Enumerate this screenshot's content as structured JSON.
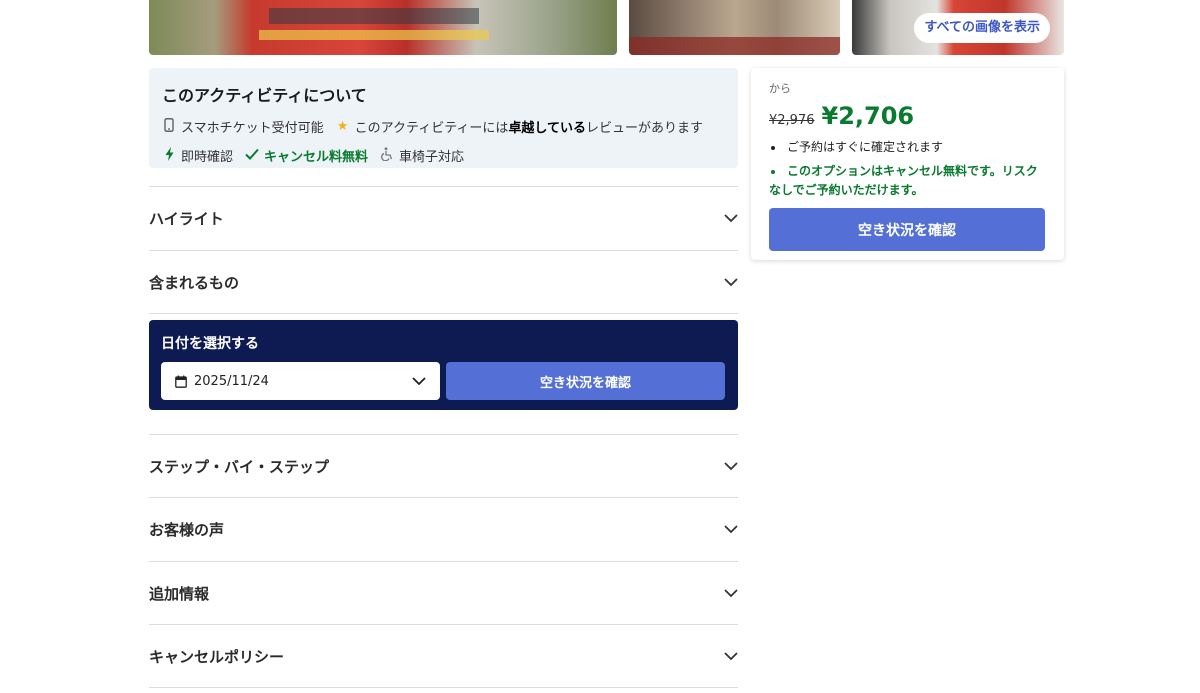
{
  "gallery": {
    "show_all_label": "すべての画像を表示"
  },
  "about": {
    "title": "このアクティビティについて",
    "features_row1": [
      {
        "icon": "mobile-phone-icon",
        "text": "スマホチケット受付可能"
      },
      {
        "icon": "star-icon",
        "pre": "このアクティビティーには",
        "bold": "卓越している",
        "post": "レビューがあります"
      }
    ],
    "features_row2": [
      {
        "icon": "lightning-bolt-icon",
        "text": "即時確認"
      },
      {
        "icon": "checkmark-icon",
        "text": "キャンセル料無料"
      },
      {
        "icon": "wheelchair-icon",
        "text": "車椅子対応"
      }
    ]
  },
  "accordion": {
    "highlights": "ハイライト",
    "included": "含まれるもの",
    "step_by_step": "ステップ・バイ・ステップ",
    "reviews": "お客様の声",
    "additional_info": "追加情報",
    "cancellation_policy": "キャンセルポリシー"
  },
  "date_picker": {
    "title": "日付を選択する",
    "selected_date": "2025/11/24",
    "check_button": "空き状況を確認"
  },
  "price_card": {
    "from_label": "から",
    "old_price": "¥2,976",
    "new_price": "¥2,706",
    "bullet_1": "ご予約はすぐに確定されます",
    "bullet_2": "このオプションはキャンセル無料です。リスクなしでご予約いただけます。",
    "check_button": "空き状況を確認"
  },
  "colors": {
    "accent_blue": "#5470d6",
    "navy_panel": "#0e1b52",
    "green": "#0a7a2f",
    "star": "#f2b01e"
  }
}
